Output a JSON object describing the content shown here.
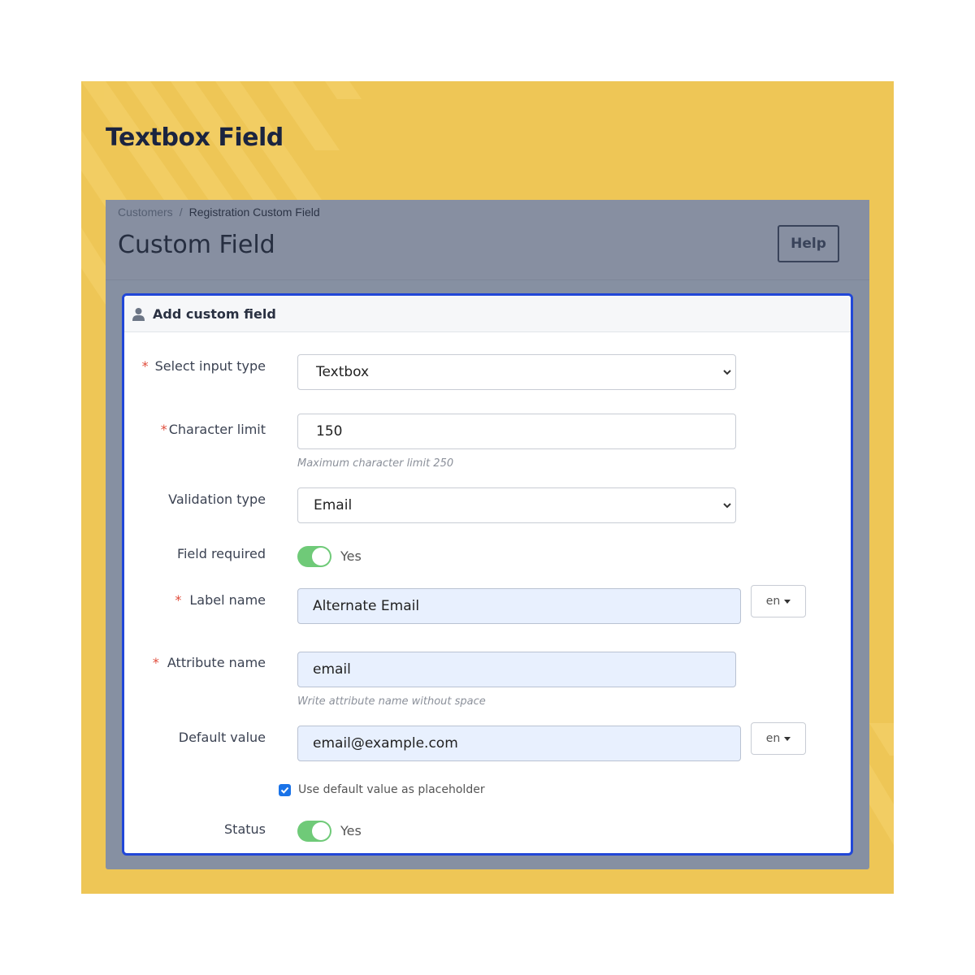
{
  "banner": {
    "title": "Textbox Field"
  },
  "page": {
    "breadcrumb": [
      "Customers",
      "Registration Custom Field"
    ],
    "title": "Custom Field",
    "help_label": "Help"
  },
  "card": {
    "title": "Add custom field",
    "icon": "user-icon",
    "fields": {
      "input_type": {
        "label": "Select input type",
        "required": true,
        "value": "Textbox"
      },
      "char_limit": {
        "label": "Character limit",
        "required": true,
        "value": "150",
        "help": "Maximum character limit 250"
      },
      "validation": {
        "label": "Validation type",
        "required": false,
        "value": "Email"
      },
      "field_required": {
        "label": "Field required",
        "toggle_label": "Yes",
        "on": true
      },
      "label_name": {
        "label": "Label name",
        "required": true,
        "value": "Alternate Email",
        "lang": "en"
      },
      "attribute_name": {
        "label": "Attribute name",
        "required": true,
        "value": "email",
        "help": "Write attribute name without space"
      },
      "default_value": {
        "label": "Default value",
        "required": false,
        "value": "email@example.com",
        "lang": "en"
      },
      "use_placeholder": {
        "label": "Use default value as placeholder",
        "checked": true
      },
      "status": {
        "label": "Status",
        "toggle_label": "Yes",
        "on": true
      }
    }
  },
  "colors": {
    "banner": "#eec656",
    "panel": "#8690a2",
    "card_border": "#2147d8",
    "toggle_on": "#6fca78",
    "required": "#e04b3a"
  }
}
